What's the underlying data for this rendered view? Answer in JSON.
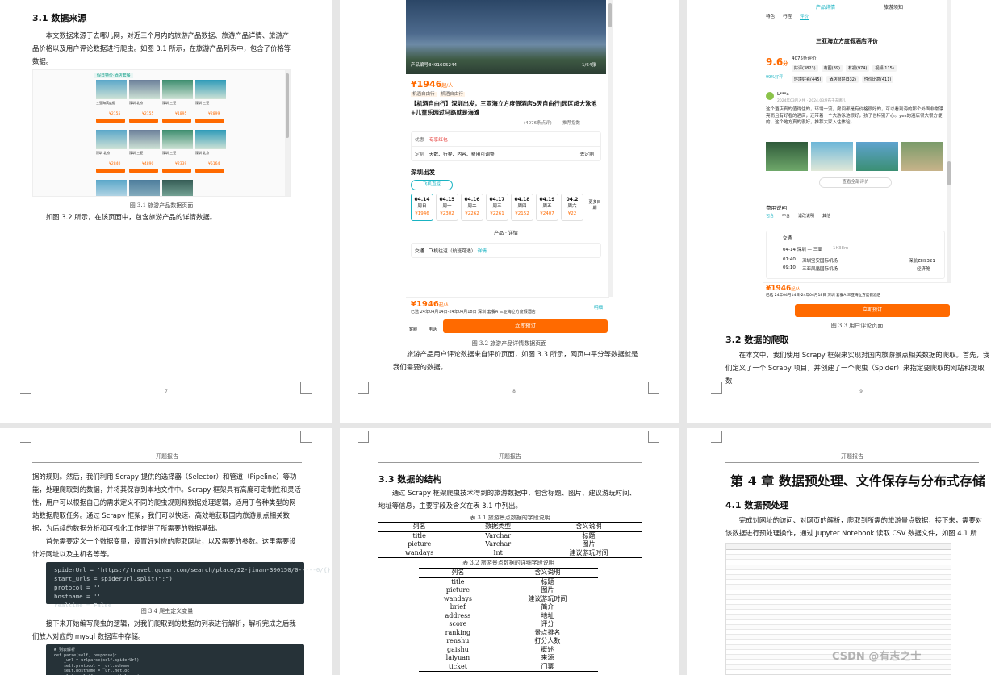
{
  "pages": {
    "p7": {
      "heading": "3.1  数据来源",
      "para1": "本文数据来源于去哪儿网，对近三个月内的旅游产品数据、旅游产品详情、旅游产品价格以及用户评论数据进行爬虫。如图 3.1 所示，在旅游产品列表中，包含了价格等数据。",
      "fig_caption": "图 3.1  旅游产品数据页面",
      "para2": "如图 3.2 所示，在该页面中，包含旅游产品的详情数据。",
      "page_num": "7",
      "shot": {
        "tag": "假日特价·酒店套餐",
        "items": [
          {
            "name": "三亚海滨度假",
            "price": "¥2155"
          },
          {
            "name": "深圳 北京",
            "price": "¥2155"
          },
          {
            "name": "深圳 三亚",
            "price": "¥1895"
          },
          {
            "name": "深圳 三亚",
            "price": "¥2899"
          },
          {
            "name": "深圳 北京",
            "price": "¥2840"
          },
          {
            "name": "深圳 三亚",
            "price": "¥4890"
          },
          {
            "name": "深圳 三亚",
            "price": "¥2339"
          },
          {
            "name": "深圳 北京",
            "price": "¥5164"
          }
        ]
      }
    },
    "p8": {
      "product_no": "产品编号3491605244",
      "photo_count": "1/64张",
      "price": "¥1946",
      "price_suffix": "起/人",
      "tag1": "机酒自由行",
      "tag2": "机酒自由行",
      "title": "【机酒自由行】深圳出发，三亚海立方度假酒店5天自由行|园区超大泳池+儿童乐园过马路就是海滩",
      "reviews": "(4076条点评)",
      "rank": "推荐指数",
      "row1_label": "优惠",
      "row1_value": "专享红包",
      "row2_label": "定制",
      "row2_value": "天数、行程、内容、费用可调整",
      "row2_action": "去定制",
      "depart_heading": "深圳出发",
      "flight_tab": "飞机直返",
      "dates": [
        {
          "d": "04.14",
          "w": "周日",
          "p": "¥1946"
        },
        {
          "d": "04.15",
          "w": "周一",
          "p": "¥2302"
        },
        {
          "d": "04.16",
          "w": "周二",
          "p": "¥2262"
        },
        {
          "d": "04.17",
          "w": "周三",
          "p": "¥2261"
        },
        {
          "d": "04.18",
          "w": "周四",
          "p": "¥2152"
        },
        {
          "d": "04.19",
          "w": "周五",
          "p": "¥2407"
        },
        {
          "d": "04.2",
          "w": "周六",
          "p": "¥22"
        }
      ],
      "more_dates": "更多日期",
      "detail_heading": "产品 · 详情",
      "traffic_label": "交通",
      "traffic_value": "飞机往返（航班可选）",
      "traffic_link": "详情",
      "bottom_price": "¥1946",
      "bottom_suffix": "起/人",
      "bottom_info": "已选  24年04月14日-24年04月18日   深圳  套餐A  三亚海立方度假酒店",
      "bottom_detail": "明细",
      "btn_left1": "客服",
      "btn_left2": "电话",
      "book_btn": "立即预订",
      "fig_caption": "图 3.2  旅游产品详情数据页面",
      "para": "旅游产品用户评论数据来自评价页面，如图 3.3 所示，网页中平分等数据就是我们需要的数据。",
      "page_num": "8"
    },
    "p9": {
      "tabs_top": [
        "产品详情",
        "旅游须知"
      ],
      "tabs_sub": [
        "特色",
        "行程",
        "评价"
      ],
      "review_title": "三亚海立方度假酒店评价",
      "score": "9.6",
      "score_unit": "分",
      "good_rate": "99%好评",
      "review_count": "4075条评价",
      "tags_row1": [
        "好评(3823)",
        "有图(89)",
        "有视(974)",
        "视频(115)"
      ],
      "tags_row2": [
        "环境好看(445)",
        "酒店很好(332)",
        "性价比高(411)"
      ],
      "user": "L***a",
      "review_date": "2024年03月入住 · 2024.03发布于去哪儿",
      "review_text": "这个酒店真的值得住的，环境一流，房间都是有价格很好的，可以看到海的那个外面非常漂亮而且有好看的酒店，还带着一个大游泳池很好，孩子也特别开心。yes的酒店很大很方便的，这个地方真的很好，推荐大家入住体验。",
      "more_reviews": "查看全部评价",
      "fee_heading": "费用说明",
      "fee_tabs": [
        "包含",
        "不含",
        "退改说明",
        "其他"
      ],
      "traffic": "交通",
      "flight_date": "04-14  深圳 — 三亚",
      "flight_time": "1h38m",
      "flight1_time": "07:40",
      "flight1_from": "深圳宝安国际机场",
      "flight1_code": "深航ZH9321",
      "flight2_time": "09:10",
      "flight2_from": "三亚凤凰国际机场",
      "flight2_code": "经济舱",
      "bottom_price": "¥1946",
      "bottom_suffix": "起/人",
      "bottom_info": "已选  24年04月14日-24年04月18日   深圳  套餐A  三亚海立方度假酒店",
      "book_btn": "立即预订",
      "fig_caption": "图 3.3  用户评论页面",
      "heading": "3.2  数据的爬取",
      "para": "在本文中，我们使用 Scrapy 框架来实现对国内旅游景点相关数据的爬取。首先，我们定义了一个 Scrapy 项目，并创建了一个爬虫（Spider）来指定要爬取的网站和提取数",
      "page_num": "9"
    },
    "p10": {
      "runhead": "开题报告",
      "para1": "据的规则。然后，我们利用 Scrapy 提供的选择器（Selector）和管道（Pipeline）等功能，处理爬取到的数据，并将其保存到本地文件中。Scrapy 框架具有高度可定制性和灵活性，用户可以根据自己的需求定义不同的爬虫规则和数据处理逻辑，适用于各种类型的网站数据爬取任务。通过 Scrapy 框架，我们可以快速、高效地获取国内旅游景点相关数据，为后续的数据分析和可视化工作提供了所需要的数据基础。",
      "para2": "首先需要定义一个数据变量，设置好对应的爬取网址，以及需要的参数。这里需要设计好网址以及主机名等等。",
      "code1": [
        "spiderUrl = 'https://travel.qunar.com/search/place/22-jinan-300150/0-----0/{}'",
        "start_urls = spiderUrl.split(\";\")",
        "protocol = ''",
        "hostname = ''",
        "realtime = False"
      ],
      "fig_caption": "图 3.4  爬虫定义变量",
      "para3": "接下来开始编写爬虫的逻辑，对我们爬取到的数据的列表进行解析，解析完成之后我们放入对应的 mysql 数据库中存储。",
      "code2": [
        "# 列表解析",
        "def parse(self, response):",
        "    _url = urlparse(self.spiderUrl)",
        "    self.protocol = _url.scheme",
        "    self.hostname = _url.netloc",
        "    plat = platform.system().lower()"
      ]
    },
    "p11": {
      "runhead": "开题报告",
      "heading": "3.3  数据的结构",
      "para": "通过 Scrapy 框架爬虫技术得到的旅游数据中，包含标题、图片、建议游玩时间、地址等信息，主要字段及含义在表 3.1 中列出。",
      "table1_caption": "表 3.1  旅游景点数据的字段说明",
      "table1_head": [
        "列名",
        "数据类型",
        "含义说明"
      ],
      "table1_rows": [
        [
          "title",
          "Varchar",
          "标题"
        ],
        [
          "picture",
          "Varchar",
          "图片"
        ],
        [
          "wandays",
          "Int",
          "建议游玩时间"
        ]
      ],
      "table2_caption": "表 3.2  旅游景点数据的详细字段说明",
      "table2_head": [
        "列名",
        "含义说明"
      ],
      "table2_rows": [
        [
          "title",
          "标题"
        ],
        [
          "picture",
          "图片"
        ],
        [
          "wandays",
          "建议游玩时间"
        ],
        [
          "brief",
          "简介"
        ],
        [
          "address",
          "地址"
        ],
        [
          "score",
          "评分"
        ],
        [
          "ranking",
          "景点排名"
        ],
        [
          "renshu",
          "打分人数"
        ],
        [
          "gaishu",
          "概述"
        ],
        [
          "laiyuan",
          "来源"
        ],
        [
          "ticket",
          "门票"
        ]
      ]
    },
    "p12": {
      "runhead": "开题报告",
      "chapter": "第 4 章    数据预处理、文件保存与分布式存储",
      "heading": "4.1  数据预处理",
      "para": "完成对网址的访问、对网页的解析，爬取到所需的旅游景点数据，接下来，需要对该数据进行预处理操作，通过 Jupyter Notebook 读取 CSV 数据文件，如图 4.1 所示。",
      "watermark": "CSDN @有志之士"
    }
  }
}
